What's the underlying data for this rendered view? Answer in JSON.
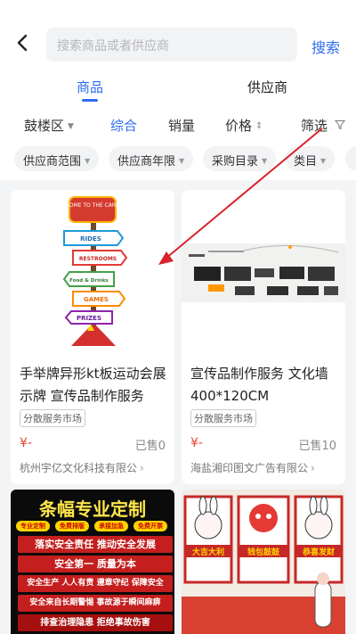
{
  "header": {
    "search_placeholder": "搜索商品或者供应商",
    "search_button": "搜索"
  },
  "tabs": [
    {
      "label": "商品",
      "active": true
    },
    {
      "label": "供应商",
      "active": false
    }
  ],
  "sort": {
    "region": "鼓楼区",
    "items": [
      "综合",
      "销量",
      "价格",
      "筛选"
    ],
    "active": "综合"
  },
  "filters": [
    "供应商范围",
    "供应商年限",
    "采购目录",
    "类目"
  ],
  "products": [
    {
      "title": "手举牌异形kt板运动会展示牌 宣传品制作服务",
      "tag": "分散服务市场",
      "price": "¥-",
      "sold": "已售0",
      "vendor": "杭州宇亿文化科技有限公",
      "image_signs": [
        "WELCOME TO THE CARNIVAL",
        "RIDES",
        "RESTROOMS",
        "Food & Drinks",
        "GAMES",
        "PRIZES"
      ]
    },
    {
      "title": "宣传品制作服务 文化墙400*120CM",
      "tag": "分散服务市场",
      "price": "¥-",
      "sold": "已售10",
      "vendor": "海盐湘印图文广告有限公"
    },
    {
      "banner_title": "条幅专业定制",
      "banner_tags": [
        "专业定制",
        "免费排版",
        "承接加急",
        "免费开票"
      ],
      "banner_lines": [
        "落实安全责任 推动安全发展",
        "安全第一 质量为本",
        "安全生产 人人有责 遵章守纪 保障安全",
        "安全来自长期警惕 事故源于瞬间麻痹",
        "排查治理隐患 拒绝事故伤害"
      ]
    },
    {
      "image_texts": [
        "大吉大利",
        "钱包鼓鼓",
        "恭喜发财"
      ]
    }
  ],
  "colors": {
    "accent": "#2d6cf0",
    "price": "#e8452f",
    "arrow": "#d8232a"
  }
}
